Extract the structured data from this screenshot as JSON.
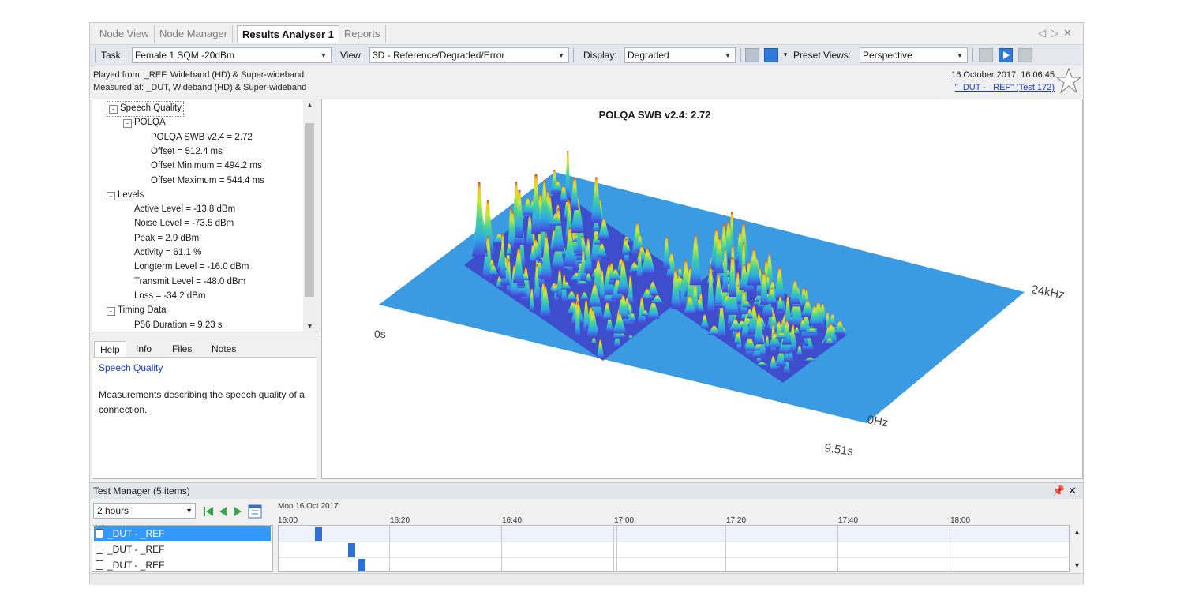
{
  "tabs": [
    "Node View",
    "Node Manager",
    "Results Analyser 1",
    "Reports"
  ],
  "toolbar": {
    "task_label": "Task:",
    "task_value": "Female 1 SQM -20dBm",
    "view_label": "View:",
    "view_value": "3D - Reference/Degraded/Error",
    "display_label": "Display:",
    "display_value": "Degraded",
    "preset_label": "Preset Views:",
    "preset_value": "Perspective"
  },
  "info": {
    "played_from": "Played from: _REF, Wideband (HD) & Super-wideband",
    "measured_at": "Measured at: _DUT, Wideband (HD) & Super-wideband",
    "date": "16 October 2017, 16:06:45",
    "test_link": "\"_DUT - _REF\" (Test 172)"
  },
  "tree": [
    {
      "text": "Speech Quality",
      "indent": 0,
      "expander": "-",
      "selected": true
    },
    {
      "text": "POLQA",
      "indent": 1,
      "expander": "-"
    },
    {
      "text": "POLQA SWB v2.4 = 2.72",
      "indent": 2
    },
    {
      "text": "Offset = 512.4 ms",
      "indent": 2
    },
    {
      "text": "Offset Minimum = 494.2 ms",
      "indent": 2
    },
    {
      "text": "Offset Maximum = 544.4 ms",
      "indent": 2
    },
    {
      "text": "Levels",
      "indent": 0,
      "expander": "-"
    },
    {
      "text": "Active Level = -13.8 dBm",
      "indent": 1
    },
    {
      "text": "Noise Level = -73.5 dBm",
      "indent": 1
    },
    {
      "text": "Peak = 2.9 dBm",
      "indent": 1
    },
    {
      "text": "Activity = 61.1 %",
      "indent": 1
    },
    {
      "text": "Longterm Level = -16.0 dBm",
      "indent": 1
    },
    {
      "text": "Transmit Level = -48.0 dBm",
      "indent": 1
    },
    {
      "text": "Loss = -34.2 dBm",
      "indent": 1
    },
    {
      "text": "Timing Data",
      "indent": 0,
      "expander": "-"
    },
    {
      "text": "P56 Duration = 9.23 s",
      "indent": 1
    }
  ],
  "help": {
    "tabs": [
      "Help",
      "Info",
      "Files",
      "Notes"
    ],
    "title": "Speech Quality",
    "text": "Measurements describing the speech quality of a connection."
  },
  "chart": {
    "title": "POLQA SWB v2.4: 2.72",
    "label_time_start": "0s",
    "label_time_end": "9.51s",
    "label_freq_low": "0Hz",
    "label_freq_high": "24kHz",
    "plane_color": "#3a9be2"
  },
  "test_manager": {
    "title": "Test Manager (5 items)",
    "range": "2 hours",
    "date": "Mon 16 Oct 2017",
    "ticks": [
      "16:00",
      "16:20",
      "16:40",
      "17:00",
      "17:20",
      "17:40",
      "18:00"
    ],
    "items": [
      "_DUT - _REF",
      "_DUT - _REF",
      "_DUT - _REF"
    ]
  }
}
